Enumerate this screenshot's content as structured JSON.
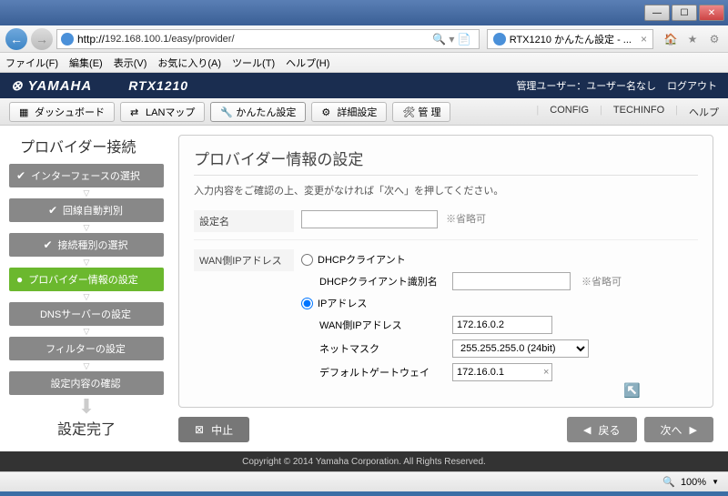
{
  "window": {
    "url": "192.168.100.1/easy/provider/",
    "tab_title": "RTX1210 かんたん設定 - ...",
    "min": "—",
    "max": "☐",
    "close": "✕"
  },
  "menubar": {
    "file": "ファイル(F)",
    "edit": "編集(E)",
    "view": "表示(V)",
    "fav": "お気に入り(A)",
    "tools": "ツール(T)",
    "help": "ヘルプ(H)"
  },
  "header": {
    "brand": "YAMAHA",
    "model": "RTX1210",
    "admin": "管理ユーザー：ユーザー名なし",
    "logout": "ログアウト"
  },
  "toolbar": {
    "dashboard": "ダッシュボード",
    "lanmap": "LANマップ",
    "easy": "かんたん設定",
    "detail": "詳細設定",
    "manage": "管 理",
    "config": "CONFIG",
    "techinfo": "TECHINFO",
    "help": "ヘルプ"
  },
  "sidebar": {
    "title": "プロバイダー接続",
    "steps": [
      "インターフェースの選択",
      "回線自動判別",
      "接続種別の選択",
      "プロバイダー情報の設定",
      "DNSサーバーの設定",
      "フィルターの設定",
      "設定内容の確認"
    ],
    "complete": "設定完了"
  },
  "form": {
    "heading": "プロバイダー情報の設定",
    "note": "入力内容をご確認の上、変更がなければ「次へ」を押してください。",
    "name_label": "設定名",
    "name_value": "",
    "name_hint": "※省略可",
    "wan_label": "WAN側IPアドレス",
    "opt_dhcp": "DHCPクライアント",
    "dhcp_id_label": "DHCPクライアント識別名",
    "dhcp_id_value": "",
    "dhcp_id_hint": "※省略可",
    "opt_ip": "IPアドレス",
    "wan_ip_label": "WAN側IPアドレス",
    "wan_ip_value": "172.16.0.2",
    "netmask_label": "ネットマスク",
    "netmask_value": "255.255.255.0 (24bit)",
    "gateway_label": "デフォルトゲートウェイ",
    "gateway_value": "172.16.0.1"
  },
  "buttons": {
    "cancel": "中止",
    "back": "戻る",
    "next": "次へ"
  },
  "footer": {
    "copyright": "Copyright © 2014 Yamaha Corporation. All Rights Reserved."
  },
  "statusbar": {
    "zoom": "100%"
  }
}
